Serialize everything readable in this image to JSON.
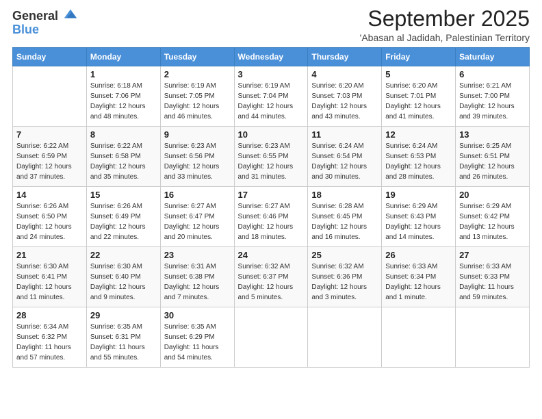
{
  "logo": {
    "general": "General",
    "blue": "Blue"
  },
  "title": "September 2025",
  "subtitle": "'Abasan al Jadidah, Palestinian Territory",
  "days_of_week": [
    "Sunday",
    "Monday",
    "Tuesday",
    "Wednesday",
    "Thursday",
    "Friday",
    "Saturday"
  ],
  "weeks": [
    [
      {
        "day": "",
        "info": ""
      },
      {
        "day": "1",
        "info": "Sunrise: 6:18 AM\nSunset: 7:06 PM\nDaylight: 12 hours\nand 48 minutes."
      },
      {
        "day": "2",
        "info": "Sunrise: 6:19 AM\nSunset: 7:05 PM\nDaylight: 12 hours\nand 46 minutes."
      },
      {
        "day": "3",
        "info": "Sunrise: 6:19 AM\nSunset: 7:04 PM\nDaylight: 12 hours\nand 44 minutes."
      },
      {
        "day": "4",
        "info": "Sunrise: 6:20 AM\nSunset: 7:03 PM\nDaylight: 12 hours\nand 43 minutes."
      },
      {
        "day": "5",
        "info": "Sunrise: 6:20 AM\nSunset: 7:01 PM\nDaylight: 12 hours\nand 41 minutes."
      },
      {
        "day": "6",
        "info": "Sunrise: 6:21 AM\nSunset: 7:00 PM\nDaylight: 12 hours\nand 39 minutes."
      }
    ],
    [
      {
        "day": "7",
        "info": "Sunrise: 6:22 AM\nSunset: 6:59 PM\nDaylight: 12 hours\nand 37 minutes."
      },
      {
        "day": "8",
        "info": "Sunrise: 6:22 AM\nSunset: 6:58 PM\nDaylight: 12 hours\nand 35 minutes."
      },
      {
        "day": "9",
        "info": "Sunrise: 6:23 AM\nSunset: 6:56 PM\nDaylight: 12 hours\nand 33 minutes."
      },
      {
        "day": "10",
        "info": "Sunrise: 6:23 AM\nSunset: 6:55 PM\nDaylight: 12 hours\nand 31 minutes."
      },
      {
        "day": "11",
        "info": "Sunrise: 6:24 AM\nSunset: 6:54 PM\nDaylight: 12 hours\nand 30 minutes."
      },
      {
        "day": "12",
        "info": "Sunrise: 6:24 AM\nSunset: 6:53 PM\nDaylight: 12 hours\nand 28 minutes."
      },
      {
        "day": "13",
        "info": "Sunrise: 6:25 AM\nSunset: 6:51 PM\nDaylight: 12 hours\nand 26 minutes."
      }
    ],
    [
      {
        "day": "14",
        "info": "Sunrise: 6:26 AM\nSunset: 6:50 PM\nDaylight: 12 hours\nand 24 minutes."
      },
      {
        "day": "15",
        "info": "Sunrise: 6:26 AM\nSunset: 6:49 PM\nDaylight: 12 hours\nand 22 minutes."
      },
      {
        "day": "16",
        "info": "Sunrise: 6:27 AM\nSunset: 6:47 PM\nDaylight: 12 hours\nand 20 minutes."
      },
      {
        "day": "17",
        "info": "Sunrise: 6:27 AM\nSunset: 6:46 PM\nDaylight: 12 hours\nand 18 minutes."
      },
      {
        "day": "18",
        "info": "Sunrise: 6:28 AM\nSunset: 6:45 PM\nDaylight: 12 hours\nand 16 minutes."
      },
      {
        "day": "19",
        "info": "Sunrise: 6:29 AM\nSunset: 6:43 PM\nDaylight: 12 hours\nand 14 minutes."
      },
      {
        "day": "20",
        "info": "Sunrise: 6:29 AM\nSunset: 6:42 PM\nDaylight: 12 hours\nand 13 minutes."
      }
    ],
    [
      {
        "day": "21",
        "info": "Sunrise: 6:30 AM\nSunset: 6:41 PM\nDaylight: 12 hours\nand 11 minutes."
      },
      {
        "day": "22",
        "info": "Sunrise: 6:30 AM\nSunset: 6:40 PM\nDaylight: 12 hours\nand 9 minutes."
      },
      {
        "day": "23",
        "info": "Sunrise: 6:31 AM\nSunset: 6:38 PM\nDaylight: 12 hours\nand 7 minutes."
      },
      {
        "day": "24",
        "info": "Sunrise: 6:32 AM\nSunset: 6:37 PM\nDaylight: 12 hours\nand 5 minutes."
      },
      {
        "day": "25",
        "info": "Sunrise: 6:32 AM\nSunset: 6:36 PM\nDaylight: 12 hours\nand 3 minutes."
      },
      {
        "day": "26",
        "info": "Sunrise: 6:33 AM\nSunset: 6:34 PM\nDaylight: 12 hours\nand 1 minute."
      },
      {
        "day": "27",
        "info": "Sunrise: 6:33 AM\nSunset: 6:33 PM\nDaylight: 11 hours\nand 59 minutes."
      }
    ],
    [
      {
        "day": "28",
        "info": "Sunrise: 6:34 AM\nSunset: 6:32 PM\nDaylight: 11 hours\nand 57 minutes."
      },
      {
        "day": "29",
        "info": "Sunrise: 6:35 AM\nSunset: 6:31 PM\nDaylight: 11 hours\nand 55 minutes."
      },
      {
        "day": "30",
        "info": "Sunrise: 6:35 AM\nSunset: 6:29 PM\nDaylight: 11 hours\nand 54 minutes."
      },
      {
        "day": "",
        "info": ""
      },
      {
        "day": "",
        "info": ""
      },
      {
        "day": "",
        "info": ""
      },
      {
        "day": "",
        "info": ""
      }
    ]
  ]
}
